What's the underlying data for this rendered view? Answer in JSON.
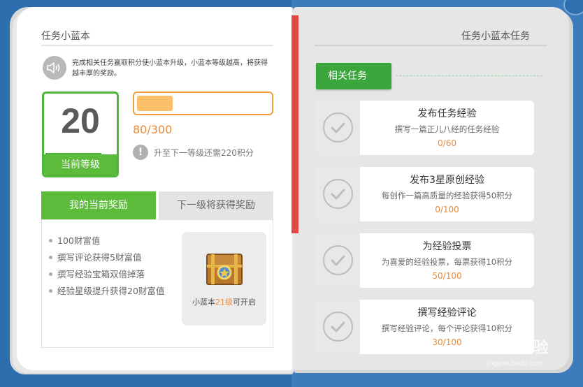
{
  "left_page": {
    "title": "任务小蓝本",
    "intro": "完成相关任务赢取积分使小蓝本升级，小蓝本等级越高，将获得越丰厚的奖励。",
    "level": {
      "value": "20",
      "label": "当前等级"
    },
    "progress": {
      "current": 80,
      "total": 300,
      "text": "80/300",
      "fraction": 0.27
    },
    "next_level_tip": "升至下一等级还需220积分",
    "tabs": [
      {
        "label": "我的当前奖励",
        "active": true
      },
      {
        "label": "下一级将获得奖励",
        "active": false
      }
    ],
    "rewards": [
      "100财富值",
      "撰写评论获得5财富值",
      "撰写经验宝箱双倍掉落",
      "经验星级提升获得20财富值"
    ],
    "chest": {
      "caption_prefix": "小蓝本",
      "caption_level": "21级",
      "caption_suffix": "可开启"
    }
  },
  "right_page": {
    "title": "任务小蓝本任务",
    "section_tag": "相关任务",
    "tasks": [
      {
        "name": "发布任务经验",
        "desc": "撰写一篇正儿八经的任务经验",
        "progress": "0/60"
      },
      {
        "name": "发布3星原创经验",
        "desc": "每创作一篇高质量的经验获得50积分",
        "progress": "0/100"
      },
      {
        "name": "为经验投票",
        "desc": "为喜爱的经验投票，每票获得10积分",
        "progress": "50/100"
      },
      {
        "name": "撰写经验评论",
        "desc": "撰写经验评论，每个评论获得10积分",
        "progress": "30/100"
      }
    ]
  },
  "watermark": {
    "text": "Baidu经验",
    "url": "jingyan.baidu.com"
  },
  "colors": {
    "green": "#5dbb3c",
    "orange": "#e98a38",
    "blue_bg": "#2f6fb0",
    "red_spine": "#e14a44"
  },
  "icons": {
    "speaker": "speaker-icon",
    "warning": "exclamation-icon",
    "check": "check-circle-icon",
    "chest": "treasure-chest-icon",
    "close": "close-icon"
  }
}
